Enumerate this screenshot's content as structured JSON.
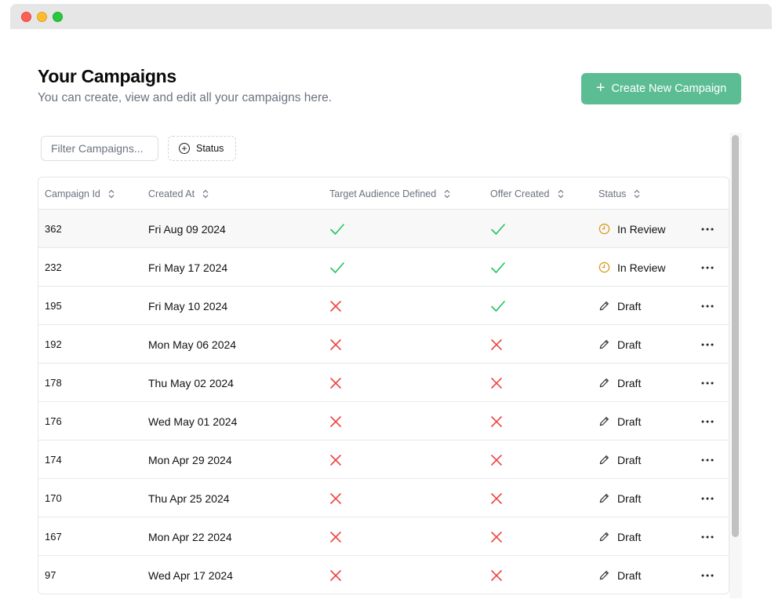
{
  "window": {},
  "header": {
    "title": "Your Campaigns",
    "subtitle": "You can create, view and edit all your campaigns here.",
    "create_button_label": "Create New Campaign"
  },
  "toolbar": {
    "filter_placeholder": "Filter Campaigns...",
    "status_filter_label": "Status"
  },
  "colors": {
    "accent": "#5cbd94",
    "check": "#22c55e",
    "cross": "#ef4444",
    "in_review": "#d99a1f"
  },
  "table": {
    "columns": [
      "Campaign Id",
      "Created At",
      "Target Audience Defined",
      "Offer Created",
      "Status"
    ],
    "rows": [
      {
        "id": "362",
        "created": "Fri Aug 09 2024",
        "target": true,
        "offer": true,
        "status": "In Review"
      },
      {
        "id": "232",
        "created": "Fri May 17 2024",
        "target": true,
        "offer": true,
        "status": "In Review"
      },
      {
        "id": "195",
        "created": "Fri May 10 2024",
        "target": false,
        "offer": true,
        "status": "Draft"
      },
      {
        "id": "192",
        "created": "Mon May 06 2024",
        "target": false,
        "offer": false,
        "status": "Draft"
      },
      {
        "id": "178",
        "created": "Thu May 02 2024",
        "target": false,
        "offer": false,
        "status": "Draft"
      },
      {
        "id": "176",
        "created": "Wed May 01 2024",
        "target": false,
        "offer": false,
        "status": "Draft"
      },
      {
        "id": "174",
        "created": "Mon Apr 29 2024",
        "target": false,
        "offer": false,
        "status": "Draft"
      },
      {
        "id": "170",
        "created": "Thu Apr 25 2024",
        "target": false,
        "offer": false,
        "status": "Draft"
      },
      {
        "id": "167",
        "created": "Mon Apr 22 2024",
        "target": false,
        "offer": false,
        "status": "Draft"
      },
      {
        "id": "97",
        "created": "Wed Apr 17 2024",
        "target": false,
        "offer": false,
        "status": "Draft"
      }
    ]
  },
  "icons": {
    "plus": "plus-icon",
    "circle_plus": "plus-circle-icon",
    "sort": "chevron-up-down-icon",
    "check": "check-icon",
    "cross": "x-icon",
    "in_review": "clock-icon",
    "draft": "pencil-icon",
    "more": "more-horizontal-icon"
  }
}
